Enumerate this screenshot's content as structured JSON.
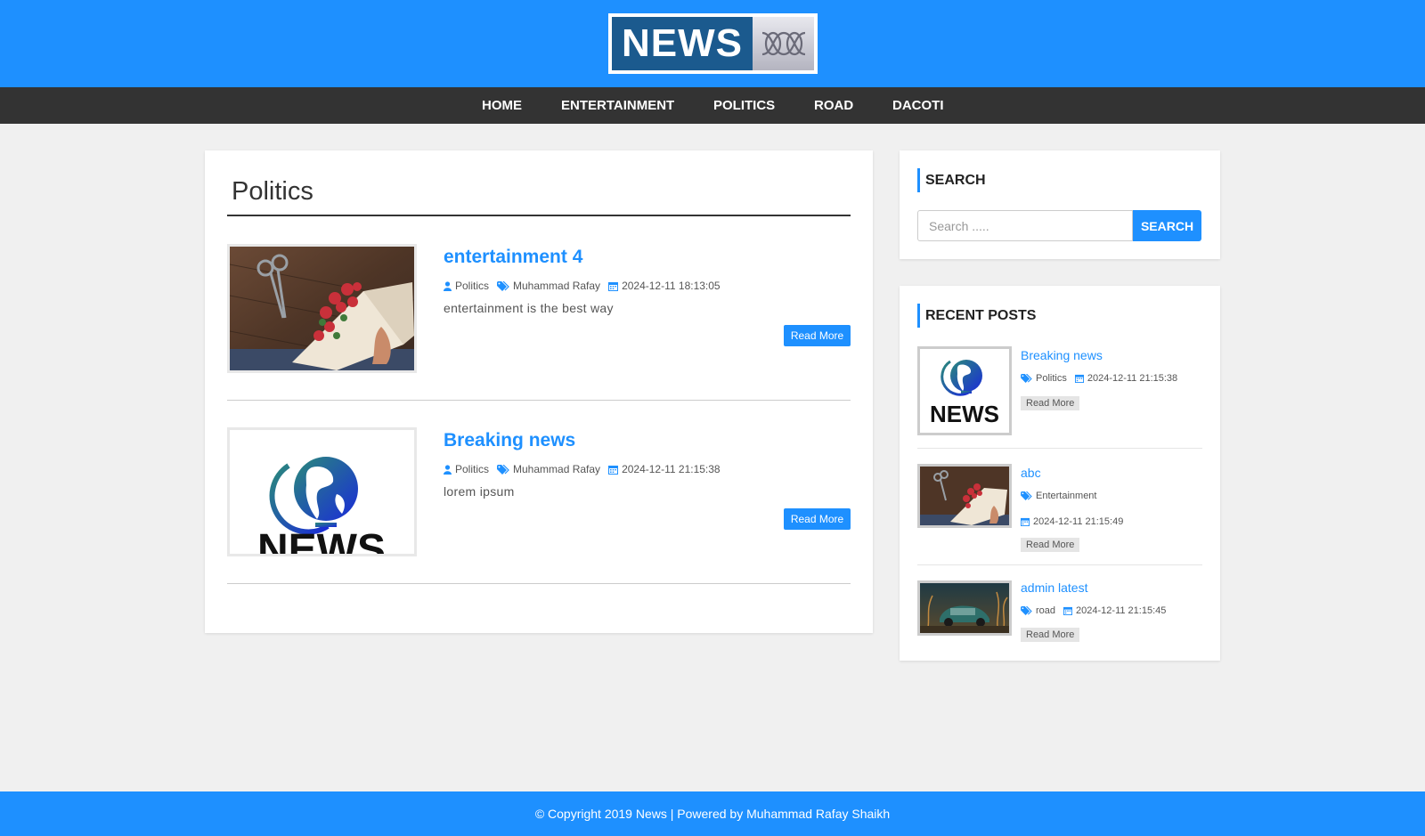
{
  "header": {
    "logo_text": "NEWS",
    "brand_color": "#1e90ff"
  },
  "nav": {
    "items": [
      {
        "label": "HOME"
      },
      {
        "label": "ENTERTAINMENT"
      },
      {
        "label": "POLITICS"
      },
      {
        "label": "ROAD"
      },
      {
        "label": "DACOTI"
      }
    ]
  },
  "main": {
    "title": "Politics",
    "posts": [
      {
        "title": "entertainment 4",
        "category": "Politics",
        "author": "Muhammad Rafay",
        "date": "2024-12-11 18:13:05",
        "excerpt": "entertainment is the best way",
        "read_more": "Read More",
        "image": "flowers-bouquet"
      },
      {
        "title": "Breaking news",
        "category": "Politics",
        "author": "Muhammad Rafay",
        "date": "2024-12-11 21:15:38",
        "excerpt": "lorem ipsum",
        "read_more": "Read More",
        "image": "news-globe-logo"
      }
    ]
  },
  "sidebar": {
    "search": {
      "heading": "SEARCH",
      "placeholder": "Search .....",
      "button": "SEARCH"
    },
    "recent": {
      "heading": "RECENT POSTS",
      "posts": [
        {
          "title": "Breaking news",
          "tag": "Politics",
          "date": "2024-12-11 21:15:38",
          "read_more": "Read More",
          "image": "news-globe-logo"
        },
        {
          "title": "abc",
          "tag": "Entertainment",
          "date": "2024-12-11 21:15:49",
          "read_more": "Read More",
          "image": "flowers-bouquet"
        },
        {
          "title": "admin latest",
          "tag": "road",
          "date": "2024-12-11 21:15:45",
          "read_more": "Read More",
          "image": "vintage-car"
        }
      ]
    }
  },
  "footer": {
    "text": "© Copyright 2019 News | Powered by Muhammad Rafay Shaikh"
  }
}
